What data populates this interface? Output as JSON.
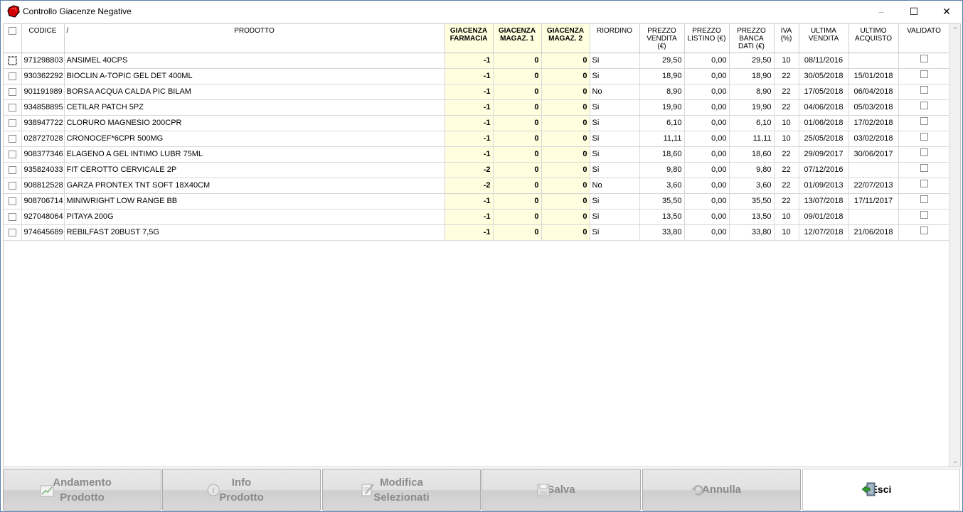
{
  "window": {
    "title": "Controllo Giacenze Negative",
    "minimize_glyph": "–",
    "maximize_glyph": "☐",
    "close_glyph": "✕"
  },
  "grid": {
    "sort_mark": "/",
    "headers": {
      "codice": "CODICE",
      "prodotto": "PRODOTTO",
      "giac_farmacia": [
        "GIACENZA",
        "FARMACIA"
      ],
      "giac_mag1": [
        "GIACENZA",
        "MAGAZ. 1"
      ],
      "giac_mag2": [
        "GIACENZA",
        "MAGAZ. 2"
      ],
      "riordino": "RIORDINO",
      "prezzo_vendita": [
        "PREZZO",
        "VENDITA",
        "(€)"
      ],
      "prezzo_listino": [
        "PREZZO",
        "LISTINO (€)"
      ],
      "prezzo_banca": [
        "PREZZO",
        "BANCA",
        "DATI (€)"
      ],
      "iva": [
        "IVA",
        "(%)"
      ],
      "ultima_vendita": [
        "ULTIMA",
        "VENDITA"
      ],
      "ultimo_acquisto": [
        "ULTIMO",
        "ACQUISTO"
      ],
      "validato": "VALIDATO"
    },
    "rows": [
      {
        "codice": "971298803",
        "prodotto": "ANSIMEL 40CPS",
        "farm": "-1",
        "mag1": "0",
        "mag2": "0",
        "riordino": "Si",
        "vendita": "29,50",
        "listino": "0,00",
        "banca": "29,50",
        "iva": "10",
        "ult_vend": "08/11/2016",
        "ult_acq": ""
      },
      {
        "codice": "930362292",
        "prodotto": "BIOCLIN A-TOPIC GEL DET 400ML",
        "farm": "-1",
        "mag1": "0",
        "mag2": "0",
        "riordino": "Si",
        "vendita": "18,90",
        "listino": "0,00",
        "banca": "18,90",
        "iva": "22",
        "ult_vend": "30/05/2018",
        "ult_acq": "15/01/2018"
      },
      {
        "codice": "901191989",
        "prodotto": "BORSA ACQUA CALDA PIC BILAM",
        "farm": "-1",
        "mag1": "0",
        "mag2": "0",
        "riordino": "No",
        "vendita": "8,90",
        "listino": "0,00",
        "banca": "8,90",
        "iva": "22",
        "ult_vend": "17/05/2018",
        "ult_acq": "06/04/2018"
      },
      {
        "codice": "934858895",
        "prodotto": "CETILAR PATCH 5PZ",
        "farm": "-1",
        "mag1": "0",
        "mag2": "0",
        "riordino": "Si",
        "vendita": "19,90",
        "listino": "0,00",
        "banca": "19,90",
        "iva": "22",
        "ult_vend": "04/06/2018",
        "ult_acq": "05/03/2018"
      },
      {
        "codice": "938947722",
        "prodotto": "CLORURO MAGNESIO 200CPR",
        "farm": "-1",
        "mag1": "0",
        "mag2": "0",
        "riordino": "Si",
        "vendita": "6,10",
        "listino": "0,00",
        "banca": "6,10",
        "iva": "10",
        "ult_vend": "01/06/2018",
        "ult_acq": "17/02/2018"
      },
      {
        "codice": "028727028",
        "prodotto": "CRONOCEF*6CPR 500MG",
        "farm": "-1",
        "mag1": "0",
        "mag2": "0",
        "riordino": "Si",
        "vendita": "11,11",
        "listino": "0,00",
        "banca": "11,11",
        "iva": "10",
        "ult_vend": "25/05/2018",
        "ult_acq": "03/02/2018"
      },
      {
        "codice": "908377346",
        "prodotto": "ELAGENO A GEL INTIMO LUBR 75ML",
        "farm": "-1",
        "mag1": "0",
        "mag2": "0",
        "riordino": "Si",
        "vendita": "18,60",
        "listino": "0,00",
        "banca": "18,60",
        "iva": "22",
        "ult_vend": "29/09/2017",
        "ult_acq": "30/06/2017"
      },
      {
        "codice": "935824033",
        "prodotto": "FIT CEROTTO CERVICALE 2P",
        "farm": "-2",
        "mag1": "0",
        "mag2": "0",
        "riordino": "Si",
        "vendita": "9,80",
        "listino": "0,00",
        "banca": "9,80",
        "iva": "22",
        "ult_vend": "07/12/2016",
        "ult_acq": ""
      },
      {
        "codice": "908812528",
        "prodotto": "GARZA PRONTEX TNT SOFT 18X40CM",
        "farm": "-2",
        "mag1": "0",
        "mag2": "0",
        "riordino": "No",
        "vendita": "3,60",
        "listino": "0,00",
        "banca": "3,60",
        "iva": "22",
        "ult_vend": "01/09/2013",
        "ult_acq": "22/07/2013"
      },
      {
        "codice": "908706714",
        "prodotto": "MINIWRIGHT LOW RANGE BB",
        "farm": "-1",
        "mag1": "0",
        "mag2": "0",
        "riordino": "Si",
        "vendita": "35,50",
        "listino": "0,00",
        "banca": "35,50",
        "iva": "22",
        "ult_vend": "13/07/2018",
        "ult_acq": "17/11/2017"
      },
      {
        "codice": "927048064",
        "prodotto": "PITAYA 200G",
        "farm": "-1",
        "mag1": "0",
        "mag2": "0",
        "riordino": "Si",
        "vendita": "13,50",
        "listino": "0,00",
        "banca": "13,50",
        "iva": "10",
        "ult_vend": "09/01/2018",
        "ult_acq": ""
      },
      {
        "codice": "974645689",
        "prodotto": "REBILFAST 20BUST 7,5G",
        "farm": "-1",
        "mag1": "0",
        "mag2": "0",
        "riordino": "Si",
        "vendita": "33,80",
        "listino": "0,00",
        "banca": "33,80",
        "iva": "10",
        "ult_vend": "12/07/2018",
        "ult_acq": "21/06/2018"
      }
    ]
  },
  "buttons": {
    "andamento": [
      "Andamento",
      "Prodotto"
    ],
    "info": [
      "Info",
      "Prodotto"
    ],
    "modifica": [
      "Modifica",
      "Selezionati"
    ],
    "salva": "Salva",
    "annulla": "Annulla",
    "esci": "Esci"
  },
  "colors": {
    "giacenza_highlight": "#ffffe0",
    "disabled_text": "#8a8a8a",
    "window_border": "#5b7fa8"
  }
}
